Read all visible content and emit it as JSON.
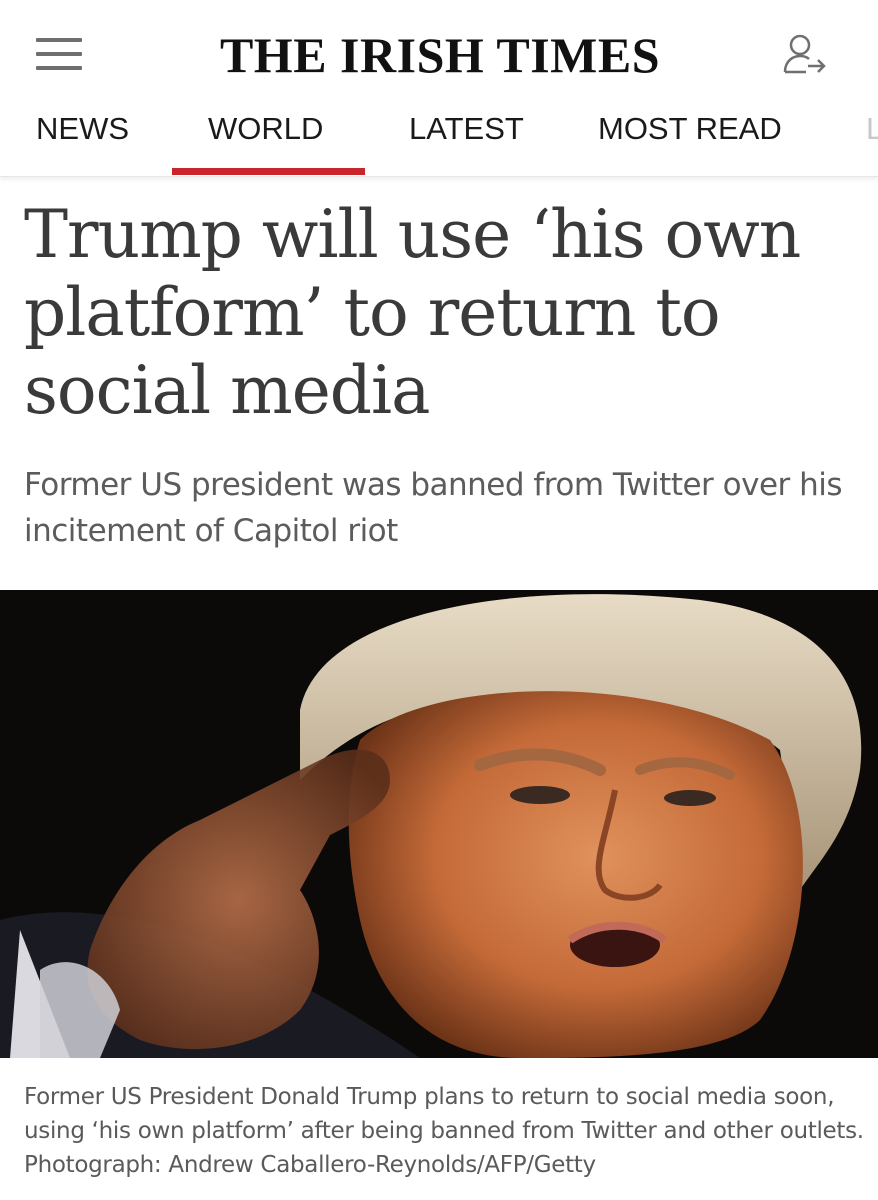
{
  "header": {
    "brand": "THE IRISH TIMES",
    "menu_icon": "hamburger-menu-icon",
    "account_icon": "account-signin-icon"
  },
  "nav": {
    "tabs": [
      {
        "label": "NEWS"
      },
      {
        "label": "WORLD",
        "active": true
      },
      {
        "label": "LATEST"
      },
      {
        "label": "MOST READ"
      },
      {
        "label": "L"
      }
    ],
    "accent_color": "#c9252c"
  },
  "article": {
    "headline": "Trump will use ‘his own platform’ to return to social media",
    "standfirst": "Former US president was banned from Twitter over his incitement of Capitol riot",
    "caption": "Former US President Donald Trump plans to return to social media soon, using ‘his own platform’ after being banned from Twitter and other outlets. Photograph: Andrew Caballero-Reynolds/AFP/Getty"
  }
}
